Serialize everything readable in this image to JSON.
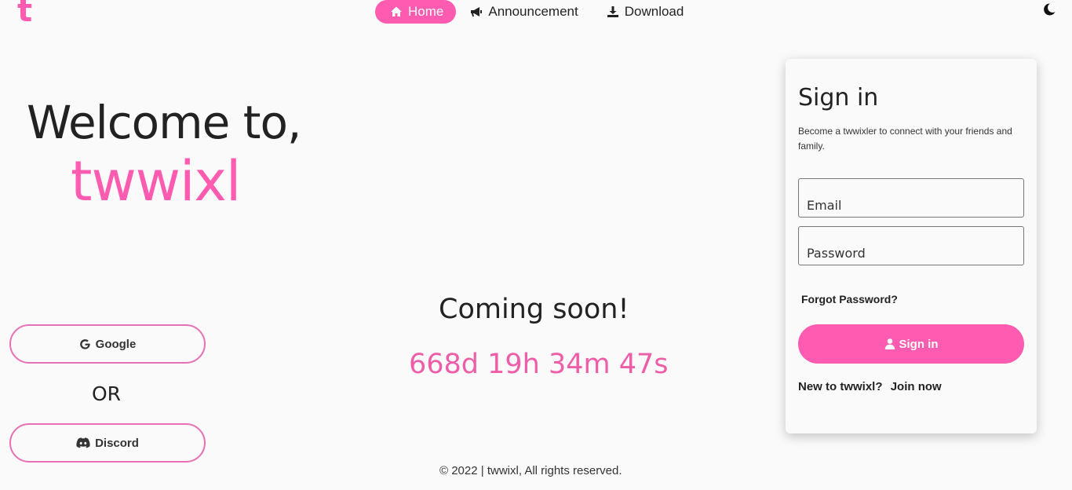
{
  "logo": "t",
  "nav": {
    "home": "Home",
    "announcement": "Announcement",
    "download": "Download"
  },
  "hero": {
    "welcome": "Welcome to,",
    "brand": "twwixl"
  },
  "social": {
    "google": "Google",
    "or": "OR",
    "discord": "Discord"
  },
  "center": {
    "coming": "Coming soon!",
    "countdown": "668d 19h 34m 47s"
  },
  "footer": "© 2022 | twwixl, All rights reserved.",
  "signin": {
    "title": "Sign in",
    "subtitle": "Become a twwixler to connect with your friends and family.",
    "email_placeholder": "Email",
    "password_placeholder": "Password",
    "forgot": "Forgot Password?",
    "button": "Sign in",
    "new_user": "New to twwixl?",
    "join": "Join now"
  },
  "colors": {
    "accent": "#ff5bb0",
    "background": "#fafafa"
  }
}
